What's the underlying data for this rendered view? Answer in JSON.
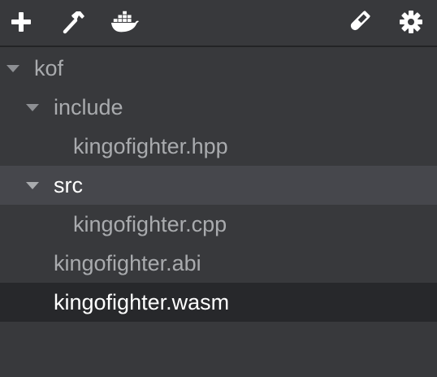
{
  "toolbar": {
    "icons": [
      "plus-icon",
      "hammer-icon",
      "docker-whale-icon",
      "test-tube-icon",
      "gear-icon"
    ]
  },
  "tree": {
    "root": {
      "label": "kof",
      "expanded": true
    },
    "include_folder": {
      "label": "include",
      "expanded": true
    },
    "include_hpp": {
      "label": "kingofighter.hpp"
    },
    "src_folder": {
      "label": "src",
      "expanded": true,
      "state": "selected"
    },
    "src_cpp": {
      "label": "kingofighter.cpp"
    },
    "abi_file": {
      "label": "kingofighter.abi"
    },
    "wasm_file": {
      "label": "kingofighter.wasm",
      "state": "active"
    }
  },
  "colors": {
    "background": "#38393c",
    "selected_row": "#46474c",
    "active_row": "#27282b",
    "text": "#a9abae",
    "text_highlight": "#ffffff"
  }
}
